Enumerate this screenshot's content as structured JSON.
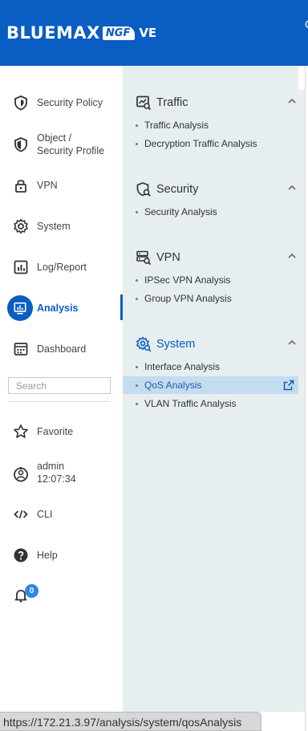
{
  "header": {
    "logo_main": "BLUEMAX",
    "logo_ngf": "NGF",
    "logo_ve": "VE",
    "edge_glyph": "C"
  },
  "colors": {
    "brand_blue": "#0a5dc2",
    "panel_bg": "#e6eef0",
    "selected_bg": "#c4dcef",
    "badge_blue": "#2e86e6"
  },
  "sidebar": {
    "items": [
      {
        "label": "Security Policy",
        "icon": "shield-icon"
      },
      {
        "label": "Object /\nSecurity Profile",
        "icon": "profile-shield-icon"
      },
      {
        "label": "VPN",
        "icon": "lock-icon"
      },
      {
        "label": "System",
        "icon": "gear-icon"
      },
      {
        "label": "Log/Report",
        "icon": "report-icon"
      },
      {
        "label": "Analysis",
        "icon": "analysis-icon",
        "active": true
      },
      {
        "label": "Dashboard",
        "icon": "dashboard-icon"
      }
    ],
    "search_placeholder": "Search",
    "bottom_items": [
      {
        "label": "Favorite",
        "icon": "star-icon"
      },
      {
        "label": "admin\n12:07:34",
        "icon": "user-icon"
      },
      {
        "label": "CLI",
        "icon": "code-icon"
      },
      {
        "label": "Help",
        "icon": "help-icon"
      }
    ],
    "notification_count": "0"
  },
  "submenu": {
    "groups": [
      {
        "title": "Traffic",
        "icon": "traffic-analysis-icon",
        "items": [
          "Traffic Analysis",
          "Decryption Traffic Analysis"
        ]
      },
      {
        "title": "Security",
        "icon": "security-analysis-icon",
        "items": [
          "Security Analysis"
        ]
      },
      {
        "title": "VPN",
        "icon": "vpn-server-icon",
        "items": [
          "IPSec VPN Analysis",
          "Group VPN Analysis"
        ]
      },
      {
        "title": "System",
        "icon": "system-gear-icon",
        "active": true,
        "items": [
          "Interface Analysis",
          "QoS Analysis",
          "VLAN Traffic Analysis"
        ]
      }
    ],
    "selected_item": "QoS Analysis"
  },
  "status_url": "https://172.21.3.97/analysis/system/qosAnalysis"
}
